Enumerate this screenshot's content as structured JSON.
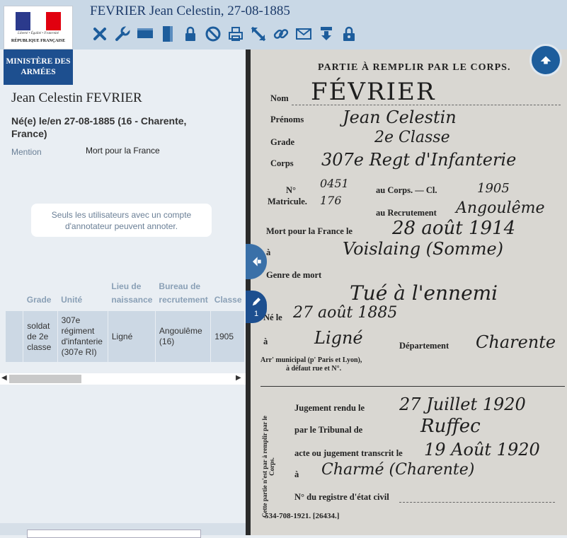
{
  "header": {
    "title": "FEVRIER Jean Celestin, 27-08-1885",
    "logo_motto": "Liberté • Égalité • Fraternité",
    "logo_republique": "RÉPUBLIQUE FRANÇAISE",
    "logo_ministry": "MINISTÈRE DES ARMÉES",
    "toolbar_icons": [
      "close-icon",
      "wrench-icon",
      "view-horizontal-icon",
      "view-vertical-icon",
      "lock-icon",
      "forbidden-icon",
      "print-icon",
      "expand-icon",
      "link-icon",
      "mail-icon",
      "download-icon",
      "lock-user-icon"
    ],
    "accent_color": "#1d4f8f"
  },
  "person": {
    "name": "Jean Celestin FEVRIER",
    "birth": "Né(e) le/en 27-08-1885 (16 - Charente, France)",
    "mention_label": "Mention",
    "mention_value": "Mort pour la France"
  },
  "notice": "Seuls les utilisateurs avec un compte d'annotateur peuvent annoter.",
  "table": {
    "headers": [
      "Grade",
      "Unité",
      "Lieu de naissance",
      "Bureau de recrutement",
      "Classe"
    ],
    "row": [
      "soldat de 2e classe",
      "307e régiment d'infanterie (307e RI)",
      "Ligné",
      "Angoulême (16)",
      "1905"
    ]
  },
  "viewer": {
    "annotation_count": "1",
    "doc": {
      "heading": "PARTIE À REMPLIR PAR LE CORPS.",
      "labels": {
        "nom": "Nom",
        "prenoms": "Prénoms",
        "grade": "Grade",
        "corps": "Corps",
        "no": "N°",
        "matricule": "Matricule.",
        "au_corps": "au Corps. — Cl.",
        "au_recrutement": "au Recrutement",
        "mort_pour": "Mort pour la France le",
        "a1": "à",
        "genre": "Genre de mort",
        "ne_le": "Né le",
        "a2": "à",
        "departement": "Département",
        "arr": "Arr' municipal (p' Paris et Lyon),",
        "defaut": "à défaut rue et N°.",
        "side_note": "Cette partie n'est par à remplir par le Corps.",
        "jugement": "Jugement rendu le",
        "tribunal": "par le Tribunal de",
        "acte": "acte ou jugement transcrit le",
        "a3": "à",
        "registre": "N° du registre d'état civil",
        "footer": "534-708-1921. [26434.]"
      },
      "handwriting": {
        "nom": "FÉVRIER",
        "prenoms": "Jean Celestin",
        "grade": "2e Classe",
        "corps": "307e Regt d'Infanterie",
        "no_corps": "0451",
        "classe": "1905",
        "no_recr": "176",
        "recr": "Angoulême",
        "date_mort": "28 août 1914",
        "lieu_mort": "Voislaing (Somme)",
        "genre": "Tué à l'ennemi",
        "ne_le": "27 août 1885",
        "ne_a": "Ligné",
        "dept": "Charente",
        "jug_date": "27 Juillet 1920",
        "tribunal": "Ruffec",
        "transcrit": "19 Août 1920",
        "transcrit_a": "Charmé (Charente)"
      }
    }
  }
}
